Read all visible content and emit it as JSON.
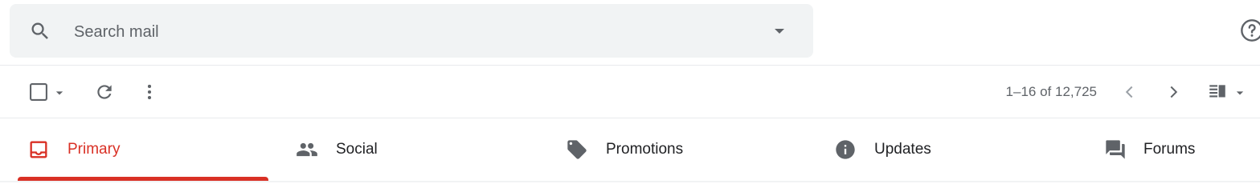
{
  "search": {
    "placeholder": "Search mail",
    "value": ""
  },
  "toolbar": {
    "pagination": "1–16 of 12,725"
  },
  "tabs": [
    {
      "label": "Primary",
      "icon": "inbox-icon",
      "active": true
    },
    {
      "label": "Social",
      "icon": "people-icon",
      "active": false
    },
    {
      "label": "Promotions",
      "icon": "tag-icon",
      "active": false
    },
    {
      "label": "Updates",
      "icon": "info-icon",
      "active": false
    },
    {
      "label": "Forums",
      "icon": "forum-icon",
      "active": false
    }
  ],
  "colors": {
    "accent": "#d93025",
    "icon": "#5f6368",
    "search_bg": "#f1f3f4",
    "text": "#202124"
  }
}
